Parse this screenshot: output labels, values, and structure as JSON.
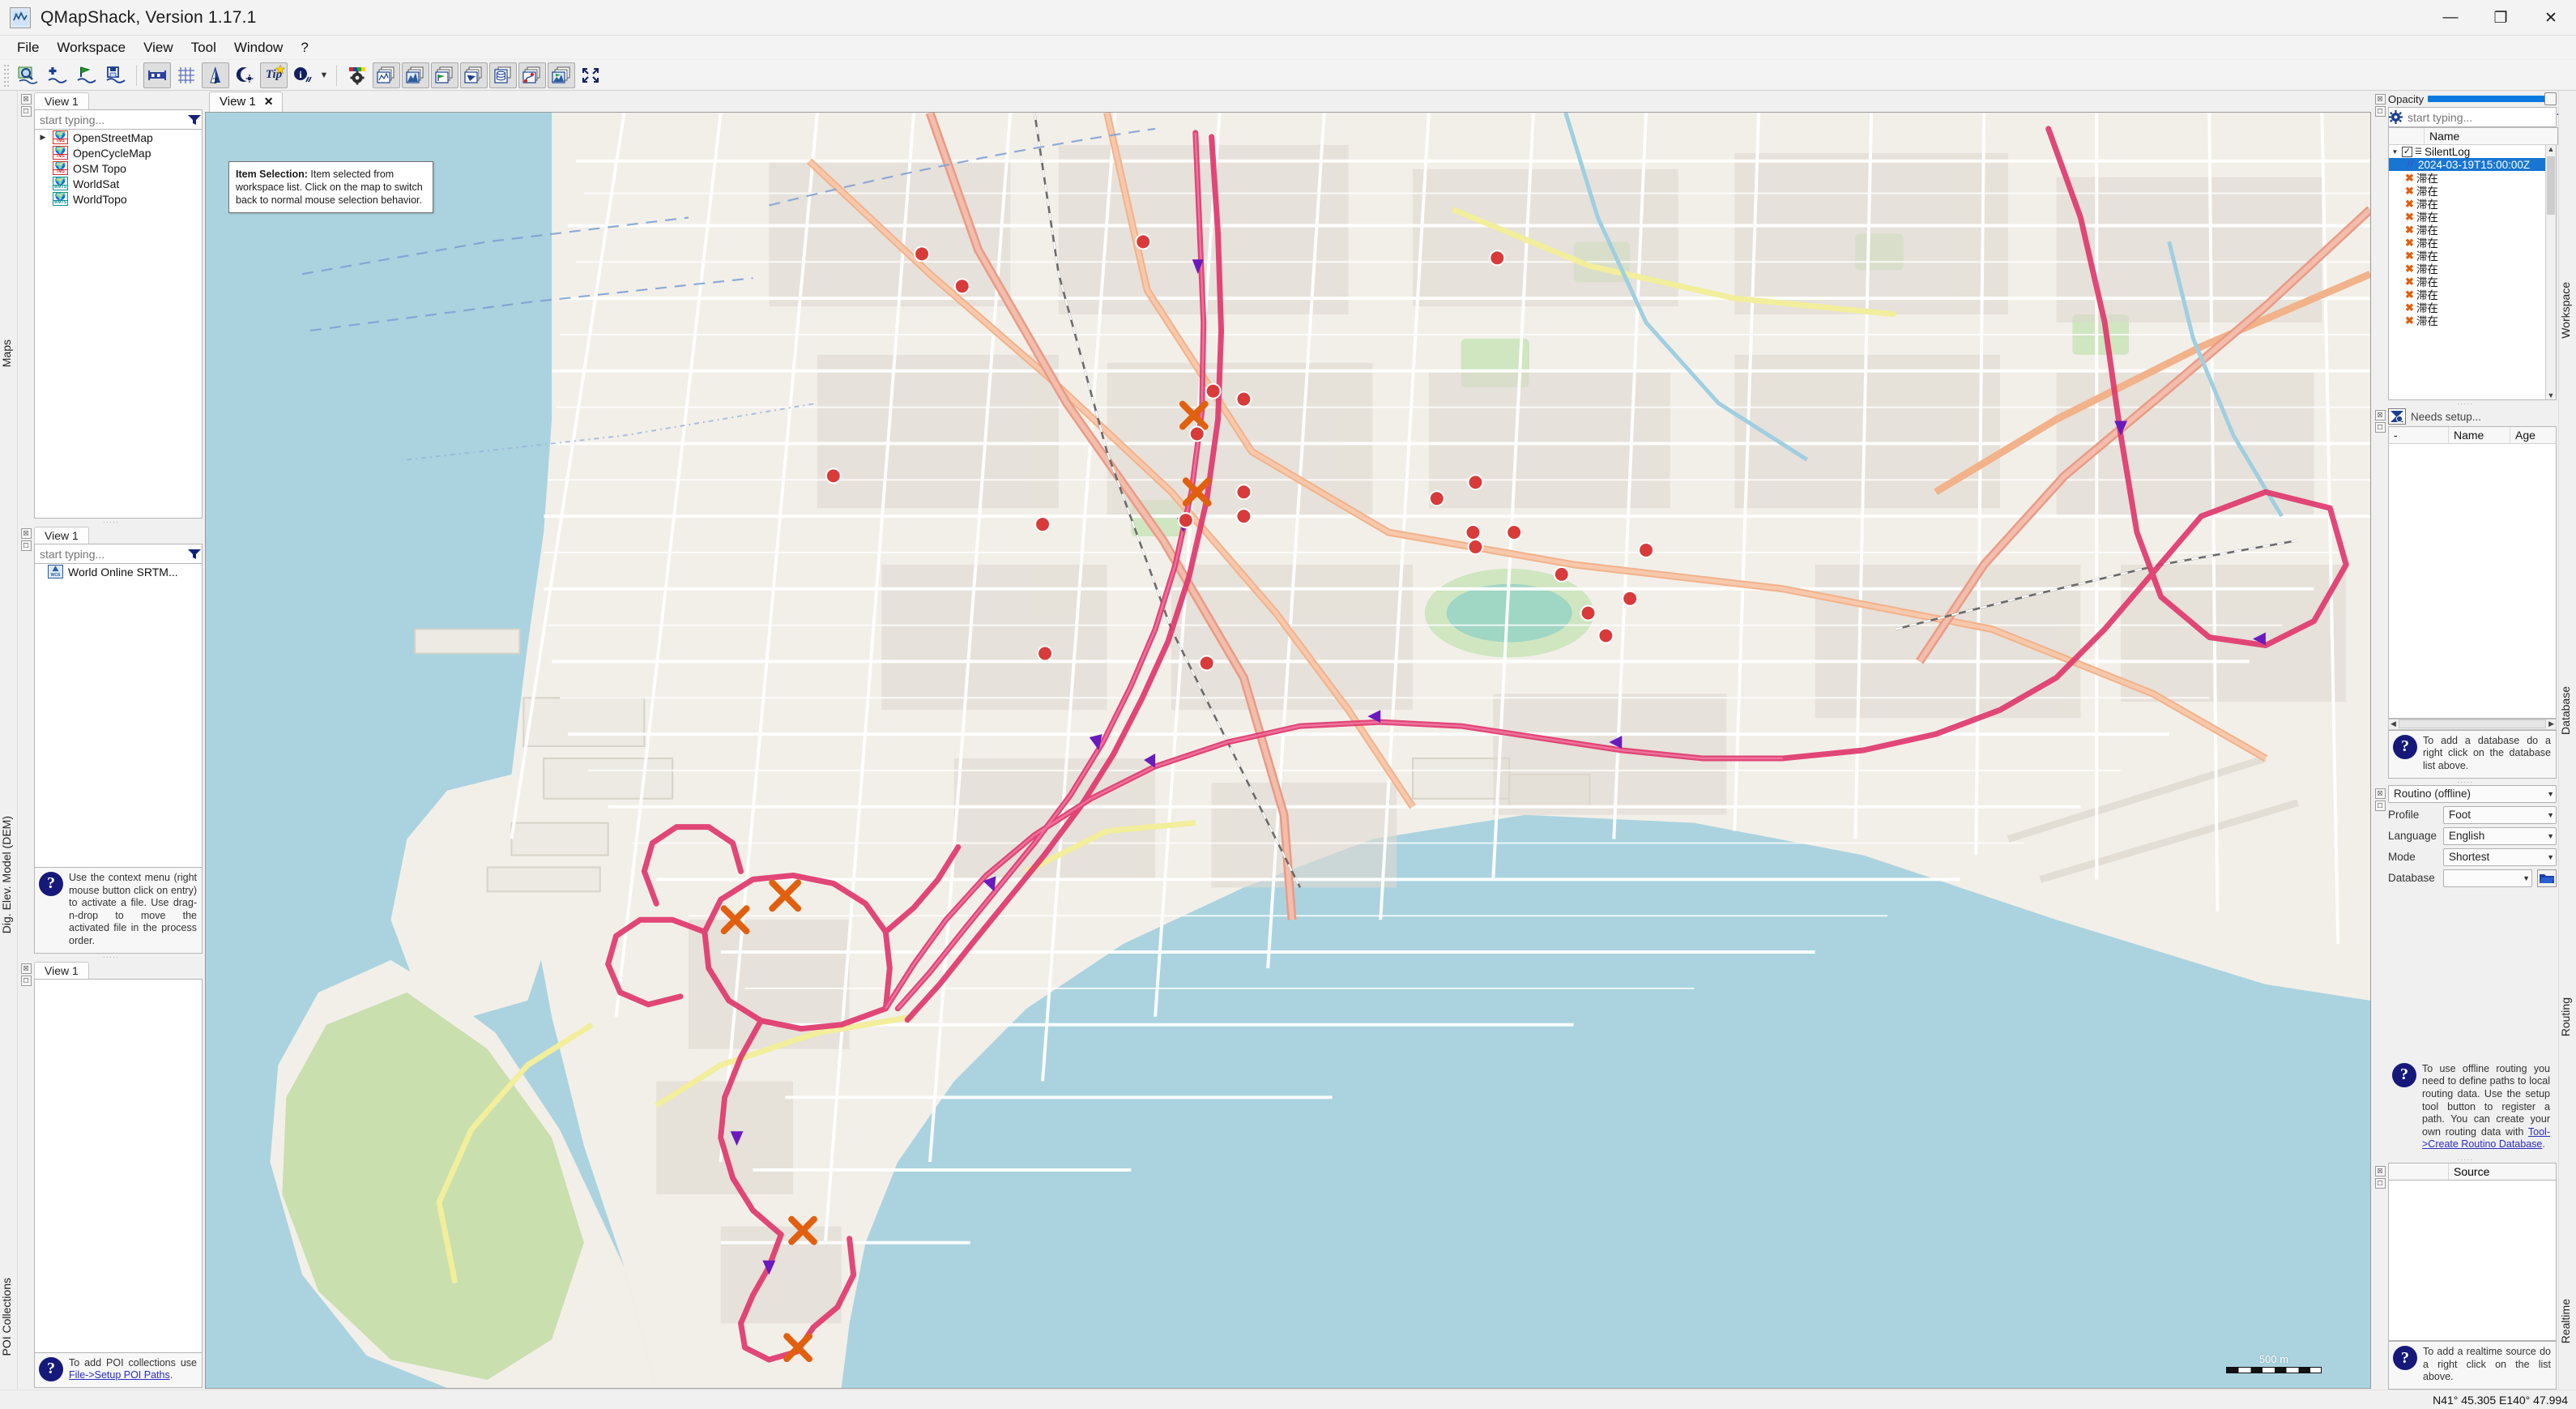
{
  "window": {
    "title": "QMapShack, Version 1.17.1",
    "app_icon": "qmapshack-icon",
    "minimize": "—",
    "maximize": "❐",
    "close": "✕"
  },
  "menubar": [
    {
      "label": "File",
      "name": "menu-file"
    },
    {
      "label": "Workspace",
      "name": "menu-workspace"
    },
    {
      "label": "View",
      "name": "menu-view"
    },
    {
      "label": "Tool",
      "name": "menu-tool"
    },
    {
      "label": "Window",
      "name": "menu-window"
    },
    {
      "label": "?",
      "name": "menu-help"
    }
  ],
  "toolbar": {
    "buttons": [
      {
        "icon": "search-map-icon",
        "pressed": false
      },
      {
        "icon": "add-track-icon",
        "pressed": false
      },
      {
        "icon": "add-waypoint-icon",
        "pressed": false
      },
      {
        "icon": "save-track-icon",
        "pressed": false
      },
      {
        "icon": "scale-bar-icon",
        "pressed": true
      },
      {
        "icon": "grid-icon",
        "pressed": false
      },
      {
        "icon": "north-text-icon",
        "pressed": true
      },
      {
        "icon": "night-mode-icon",
        "pressed": false
      },
      {
        "icon": "tip-of-day-icon",
        "pressed": true
      },
      {
        "icon": "info-icon",
        "pressed": false
      },
      {
        "icon": "chevron-down-icon",
        "pressed": false
      },
      {
        "icon": "color-gear-icon",
        "pressed": false
      },
      {
        "icon": "maps-dock-icon",
        "pressed": true
      },
      {
        "icon": "dem-dock-icon",
        "pressed": true
      },
      {
        "icon": "workspace-dock-icon",
        "pressed": true
      },
      {
        "icon": "realtime-dock-icon",
        "pressed": true
      },
      {
        "icon": "database-dock-icon",
        "pressed": true
      },
      {
        "icon": "routing-dock-icon",
        "pressed": true
      },
      {
        "icon": "poi-dock-icon",
        "pressed": true
      },
      {
        "icon": "fullscreen-icon",
        "pressed": false
      }
    ],
    "tip_label": "Tip"
  },
  "left_dock": {
    "maps_panel": {
      "side_label": "Maps",
      "tab_label": "View 1",
      "filter_placeholder": "start typing...",
      "filter_value": "",
      "items": [
        {
          "label": "OpenStreetMap",
          "badge": "TMS",
          "color": "red",
          "expandable": true
        },
        {
          "label": "OpenCycleMap",
          "badge": "TMS",
          "color": "red",
          "expandable": false
        },
        {
          "label": "OSM Topo",
          "badge": "TMS",
          "color": "red",
          "expandable": false
        },
        {
          "label": "WorldSat",
          "badge": "WMTS",
          "color": "teal",
          "expandable": false
        },
        {
          "label": "WorldTopo",
          "badge": "WMTS",
          "color": "teal",
          "expandable": false
        }
      ]
    },
    "dem_panel": {
      "side_label": "Dig. Elev. Model (DEM)",
      "tab_label": "View 1",
      "filter_placeholder": "start typing...",
      "filter_value": "",
      "items": [
        {
          "label": "World Online SRTM...",
          "badge": "WCS"
        }
      ],
      "hint": "Use the context menu (right mouse button click on entry) to activate a file. Use drag-n-drop to move the activated file in the process order."
    },
    "poi_panel": {
      "side_label": "POI Collections",
      "tab_label": "View 1",
      "hint_prefix": "To add POI collections use ",
      "hint_link": "File->Setup POI Paths",
      "hint_suffix": "."
    }
  },
  "map": {
    "tab_label": "View 1",
    "tab_close": "✕",
    "info_bubble_title": "Item Selection:",
    "info_bubble_text": " Item selected from workspace list. Click on the map to switch back to normal mouse selection behavior.",
    "scale_label": "500 m",
    "track_color": "#e0386e",
    "sea_color": "#aad3df",
    "land_color": "#f2efe9",
    "forest_color": "#c9dfae"
  },
  "right_dock": {
    "workspace_panel": {
      "side_label": "Workspace",
      "opacity_label": "Opacity",
      "opacity_value": 100,
      "filter_placeholder": "start typing...",
      "filter_value": "",
      "gear_icon": "gear-icon",
      "help_icon": "question-icon",
      "funnel_icon": "funnel-icon",
      "columns": [
        "",
        "Name"
      ],
      "rows": [
        {
          "label": "SilentLog",
          "icon": "log-file-icon",
          "checked": true,
          "expanded": true,
          "level": 0,
          "selected": false
        },
        {
          "label": "2024-03-19T15:00:00Z",
          "icon": "track-icon",
          "level": 1,
          "selected": true
        },
        {
          "label": "滞在",
          "icon": "waypoint-cross-icon",
          "level": 1,
          "selected": false
        },
        {
          "label": "滞在",
          "icon": "waypoint-cross-icon",
          "level": 1,
          "selected": false
        },
        {
          "label": "滞在",
          "icon": "waypoint-cross-icon",
          "level": 1,
          "selected": false
        },
        {
          "label": "滞在",
          "icon": "waypoint-cross-icon",
          "level": 1,
          "selected": false
        },
        {
          "label": "滞在",
          "icon": "waypoint-cross-icon",
          "level": 1,
          "selected": false
        },
        {
          "label": "滞在",
          "icon": "waypoint-cross-icon",
          "level": 1,
          "selected": false
        },
        {
          "label": "滞在",
          "icon": "waypoint-cross-icon",
          "level": 1,
          "selected": false
        },
        {
          "label": "滞在",
          "icon": "waypoint-cross-icon",
          "level": 1,
          "selected": false
        },
        {
          "label": "滞在",
          "icon": "waypoint-cross-icon",
          "level": 1,
          "selected": false
        },
        {
          "label": "滞在",
          "icon": "waypoint-cross-icon",
          "level": 1,
          "selected": false
        },
        {
          "label": "滞在",
          "icon": "waypoint-cross-icon",
          "level": 1,
          "selected": false
        },
        {
          "label": "滞在",
          "icon": "waypoint-cross-icon",
          "level": 1,
          "selected": false
        }
      ]
    },
    "database_panel": {
      "side_label": "Database",
      "setup_text": "Needs setup...",
      "setup_icon": "database-setup-icon",
      "columns": [
        "-",
        "Name",
        "Age"
      ],
      "rows": [],
      "hint": "To add a database do a right click on the database list above."
    },
    "routing_panel": {
      "side_label": "Routing",
      "service": "Routino (offline)",
      "fields": [
        {
          "label": "Profile",
          "value": "Foot"
        },
        {
          "label": "Language",
          "value": "English"
        },
        {
          "label": "Mode",
          "value": "Shortest"
        },
        {
          "label": "Database",
          "value": ""
        }
      ],
      "folder_icon": "folder-icon",
      "hint_prefix": "To use offline routing you need to define paths to local routing data. Use the setup tool button to register a path. You can create your own routing data with ",
      "hint_link": "Tool->Create Routino Database",
      "hint_suffix": "."
    },
    "realtime_panel": {
      "side_label": "Realtime",
      "columns": [
        "",
        "Source"
      ],
      "rows": [],
      "hint": "To add a realtime source do a right click on the list above."
    }
  },
  "statusbar": {
    "coordinates": "N41° 45.305 E140° 47.994"
  }
}
